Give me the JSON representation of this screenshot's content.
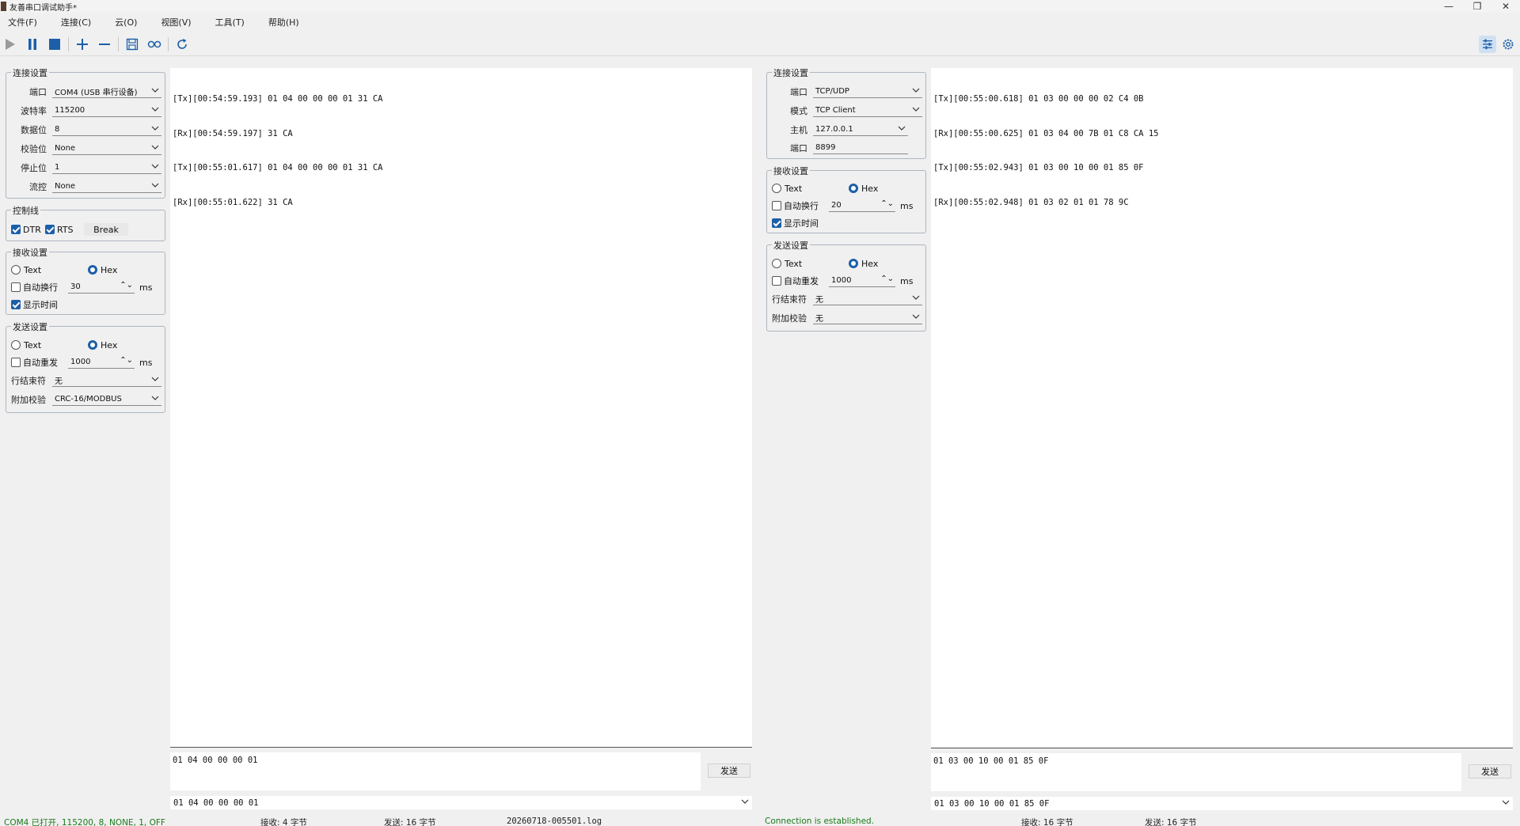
{
  "window": {
    "title": "友善串口调试助手*"
  },
  "menu": [
    "文件(F)",
    "连接(C)",
    "云(O)",
    "视图(V)",
    "工具(T)",
    "帮助(H)"
  ],
  "toolbar": {
    "icons": [
      "play-icon",
      "pause-icon",
      "stop-icon",
      "add-icon",
      "remove-icon",
      "save-icon",
      "loop-icon",
      "refresh-icon"
    ],
    "right_icons": [
      "settings-panel-icon",
      "gear-icon"
    ]
  },
  "left": {
    "conn": {
      "title": "连接设置",
      "port_label": "端口",
      "port_value": "COM4 (USB 串行设备)",
      "baud_label": "波特率",
      "baud_value": "115200",
      "data_label": "数据位",
      "data_value": "8",
      "parity_label": "校验位",
      "parity_value": "None",
      "stop_label": "停止位",
      "stop_value": "1",
      "flow_label": "流控",
      "flow_value": "None"
    },
    "control": {
      "title": "控制线",
      "dtr": "DTR",
      "rts": "RTS",
      "break": "Break"
    },
    "recv": {
      "title": "接收设置",
      "text": "Text",
      "hex": "Hex",
      "auto_wrap": "自动换行",
      "wrap_value": "30",
      "unit": "ms",
      "show_time": "显示时间"
    },
    "send": {
      "title": "发送设置",
      "text": "Text",
      "hex": "Hex",
      "auto_resend": "自动重发",
      "resend_value": "1000",
      "unit": "ms",
      "eol_label": "行结束符",
      "eol_value": "无",
      "check_label": "附加校验",
      "check_value": "CRC-16/MODBUS"
    }
  },
  "log1": {
    "lines": [
      "[Tx][00:54:59.193] 01 04 00 00 00 01 31 CA",
      "[Rx][00:54:59.197] 31 CA",
      "[Tx][00:55:01.617] 01 04 00 00 00 01 31 CA",
      "[Rx][00:55:01.622] 31 CA"
    ],
    "send_text": "01 04 00 00 00 01",
    "send_button": "发送",
    "history": "01 04 00 00 00 01"
  },
  "right": {
    "conn": {
      "title": "连接设置",
      "port_label": "端口",
      "port_value": "TCP/UDP",
      "mode_label": "模式",
      "mode_value": "TCP Client",
      "host_label": "主机",
      "host_value": "127.0.0.1",
      "rport_label": "端口",
      "rport_value": "8899"
    },
    "recv": {
      "title": "接收设置",
      "text": "Text",
      "hex": "Hex",
      "auto_wrap": "自动换行",
      "wrap_value": "20",
      "unit": "ms",
      "show_time": "显示时间"
    },
    "send": {
      "title": "发送设置",
      "text": "Text",
      "hex": "Hex",
      "auto_resend": "自动重发",
      "resend_value": "1000",
      "unit": "ms",
      "eol_label": "行结束符",
      "eol_value": "无",
      "check_label": "附加校验",
      "check_value": "无"
    }
  },
  "log2": {
    "lines": [
      "[Tx][00:55:00.618] 01 03 00 00 00 02 C4 0B",
      "[Rx][00:55:00.625] 01 03 04 00 7B 01 C8 CA 15",
      "[Tx][00:55:02.943] 01 03 00 10 00 01 85 0F",
      "[Rx][00:55:02.948] 01 03 02 01 01 78 9C"
    ],
    "send_text": "01 03 00 10 00 01 85 0F",
    "send_button": "发送",
    "history": "01 03 00 10 00 01 85 0F"
  },
  "status": {
    "s1": "COM4 已打开, 115200, 8, NONE, 1, OFF",
    "s2": "接收: 4 字节",
    "s3": "发送: 16 字节",
    "s4": "20260718-005501.log",
    "s5": "Connection is established.",
    "s6": "接收: 16 字节",
    "s7": "发送: 16 字节"
  },
  "colors": {
    "accent": "#1c5fa8",
    "status_green": "#1a7a1a"
  }
}
